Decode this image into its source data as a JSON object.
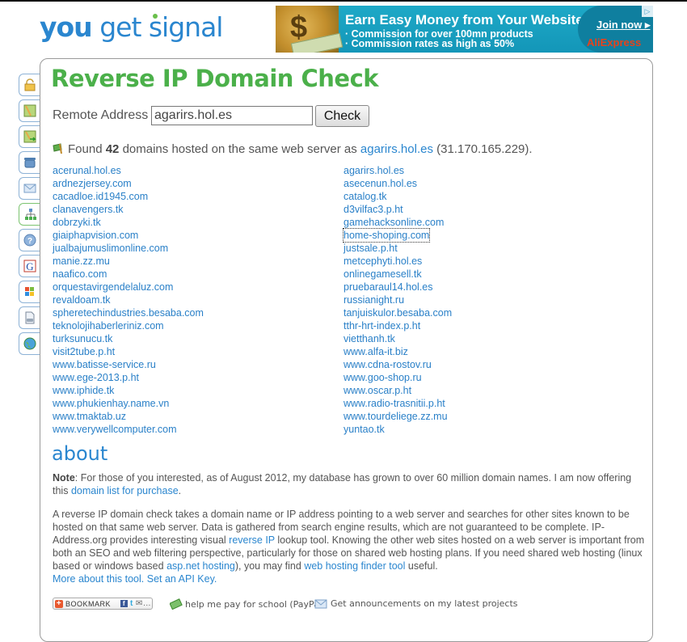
{
  "logo": {
    "you": "you",
    "rest": "get signal"
  },
  "ad": {
    "headline": "Earn Easy Money from Your Website!",
    "line1": "· Commission for over 100mn products",
    "line2": "· Commission rates as high as 50%",
    "cta": "Join now ▸",
    "brand": "AliExpress",
    "adchoices": "▷"
  },
  "sidebar": {
    "items": [
      {
        "icon": "lock-icon"
      },
      {
        "icon": "map-icon"
      },
      {
        "icon": "map-route-icon"
      },
      {
        "icon": "phone-icon"
      },
      {
        "icon": "mail-icon"
      },
      {
        "icon": "network-icon",
        "active": true
      },
      {
        "icon": "help-icon"
      },
      {
        "icon": "google-icon"
      },
      {
        "icon": "windows-icon"
      },
      {
        "icon": "document-icon"
      },
      {
        "icon": "globe-icon"
      }
    ]
  },
  "page": {
    "title": "Reverse IP Domain Check",
    "remote_label": "Remote Address",
    "remote_value": "agarirs.hol.es",
    "check_label": "Check"
  },
  "result": {
    "prefix": "Found",
    "count": "42",
    "middle": "domains hosted on the same web server as",
    "domain": "agarirs.hol.es",
    "ip": "(31.170.165.229)."
  },
  "domains": {
    "col1": [
      "acerunal.hol.es",
      "ardnezjersey.com",
      "cacadloe.id1945.com",
      "clanavengers.tk",
      "dobrzyki.tk",
      "giaiphapvision.com",
      "jualbajumuslimonline.com",
      "manie.zz.mu",
      "naafico.com",
      "orquestavirgendelaluz.com",
      "revaldoam.tk",
      "spheretechindustries.besaba.com",
      "teknolojihaberleriniz.com",
      "turksunucu.tk",
      "visit2tube.p.ht",
      "www.batisse-service.ru",
      "www.ege-2013.p.ht",
      "www.iphide.tk",
      "www.phukienhay.name.vn",
      "www.tmaktab.uz",
      "www.verywellcomputer.com"
    ],
    "col2": [
      "agarirs.hol.es",
      "asecenun.hol.es",
      "catalog.tk",
      "d3vilfac3.p.ht",
      "gamehacksonline.com",
      "home-shoping.com",
      "justsale.p.ht",
      "metcephyti.hol.es",
      "onlinegamesell.tk",
      "pruebaraul14.hol.es",
      "russianight.ru",
      "tanjuiskulor.besaba.com",
      "tthr-hrt-index.p.ht",
      "vietthanh.tk",
      "www.alfa-it.biz",
      "www.cdna-rostov.ru",
      "www.goo-shop.ru",
      "www.oscar.p.ht",
      "www.radio-trasnitii.p.ht",
      "www.tourdeliege.zz.mu",
      "yuntao.tk"
    ],
    "focused": "home-shoping.com"
  },
  "about": {
    "heading": "about",
    "note_label": "Note",
    "note_text": ": For those of you interested, as of August 2012, my database has grown to over 60 million domain names. I am now offering this ",
    "note_link": "domain list for purchase",
    "note_end": ".",
    "p2_a": "A reverse IP domain check takes a domain name or IP address pointing to a web server and searches for other sites known to be hosted on that same web server. Data is gathered from search engine results, which are not guaranteed to be complete. IP-Address.org provides interesting visual ",
    "p2_link1": "reverse IP",
    "p2_b": " lookup tool. Knowing the other web sites hosted on a web server is important from both an SEO and web filtering perspective, particularly for those on shared web hosting plans. If you need shared web hosting (linux based or windows based ",
    "p2_link2": "asp.net hosting",
    "p2_c": "), you may find ",
    "p2_link3": "web hosting finder tool",
    "p2_d": " useful.",
    "more_link": "More about this tool.",
    "api_link": "Set an API Key."
  },
  "footer": {
    "bookmark": "BOOKMARK",
    "paypal": "help me pay for school (PayPal)",
    "news": "Get announcements on my latest projects"
  }
}
